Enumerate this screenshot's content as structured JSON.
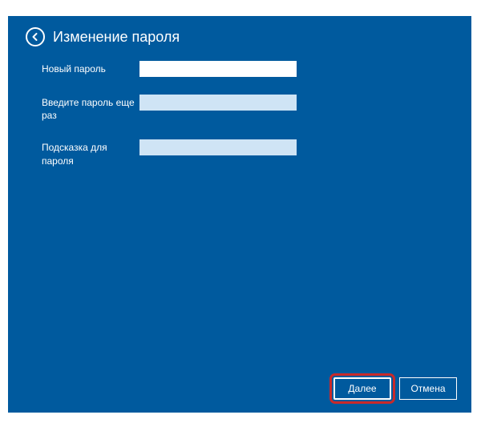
{
  "header": {
    "title": "Изменение пароля"
  },
  "fields": {
    "new_password": {
      "label": "Новый пароль",
      "value": ""
    },
    "confirm_password": {
      "label": "Введите пароль еще раз",
      "value": ""
    },
    "hint": {
      "label": "Подсказка для пароля",
      "value": ""
    }
  },
  "buttons": {
    "next": "Далее",
    "cancel": "Отмена"
  },
  "colors": {
    "background": "#005a9e",
    "highlight": "#c92a2a"
  }
}
